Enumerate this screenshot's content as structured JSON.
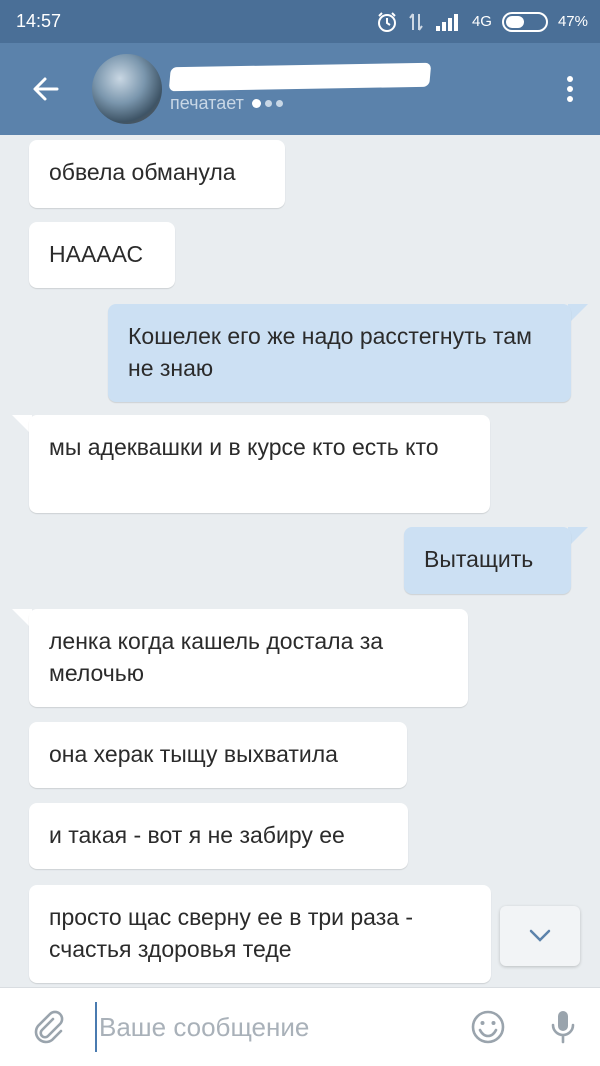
{
  "status_bar": {
    "time": "14:57",
    "network": "4G",
    "battery": "47%",
    "battery_level": 0.47
  },
  "header": {
    "typing_text": "печатает",
    "icons": {
      "back": "arrow-left-icon",
      "menu": "more-vertical-icon"
    }
  },
  "messages": [
    {
      "direction": "in",
      "text": "обвела обманула"
    },
    {
      "direction": "in",
      "text": "НААААС"
    },
    {
      "direction": "out",
      "text": "Кошелек его же надо расстегнуть там не знаю"
    },
    {
      "direction": "in",
      "text": "мы адеквашки и в курсе кто есть кто"
    },
    {
      "direction": "out",
      "text": "Вытащить"
    },
    {
      "direction": "in",
      "text": "ленка когда кашель достала за мелочью"
    },
    {
      "direction": "in",
      "text": "она херак тыщу выхватила"
    },
    {
      "direction": "in",
      "text": "и такая - вот я не забиру ее"
    },
    {
      "direction": "in",
      "text": "просто щас сверну ее в три раза - счастья здоровья теде"
    }
  ],
  "composer": {
    "placeholder": "Ваше сообщение",
    "value": ""
  },
  "colors": {
    "status_bar": "#4a6f97",
    "header": "#5b82ab",
    "background": "#e9edf0",
    "incoming_bubble": "#ffffff",
    "outgoing_bubble": "#cce0f3",
    "icon_gray": "#9aa4ad"
  }
}
